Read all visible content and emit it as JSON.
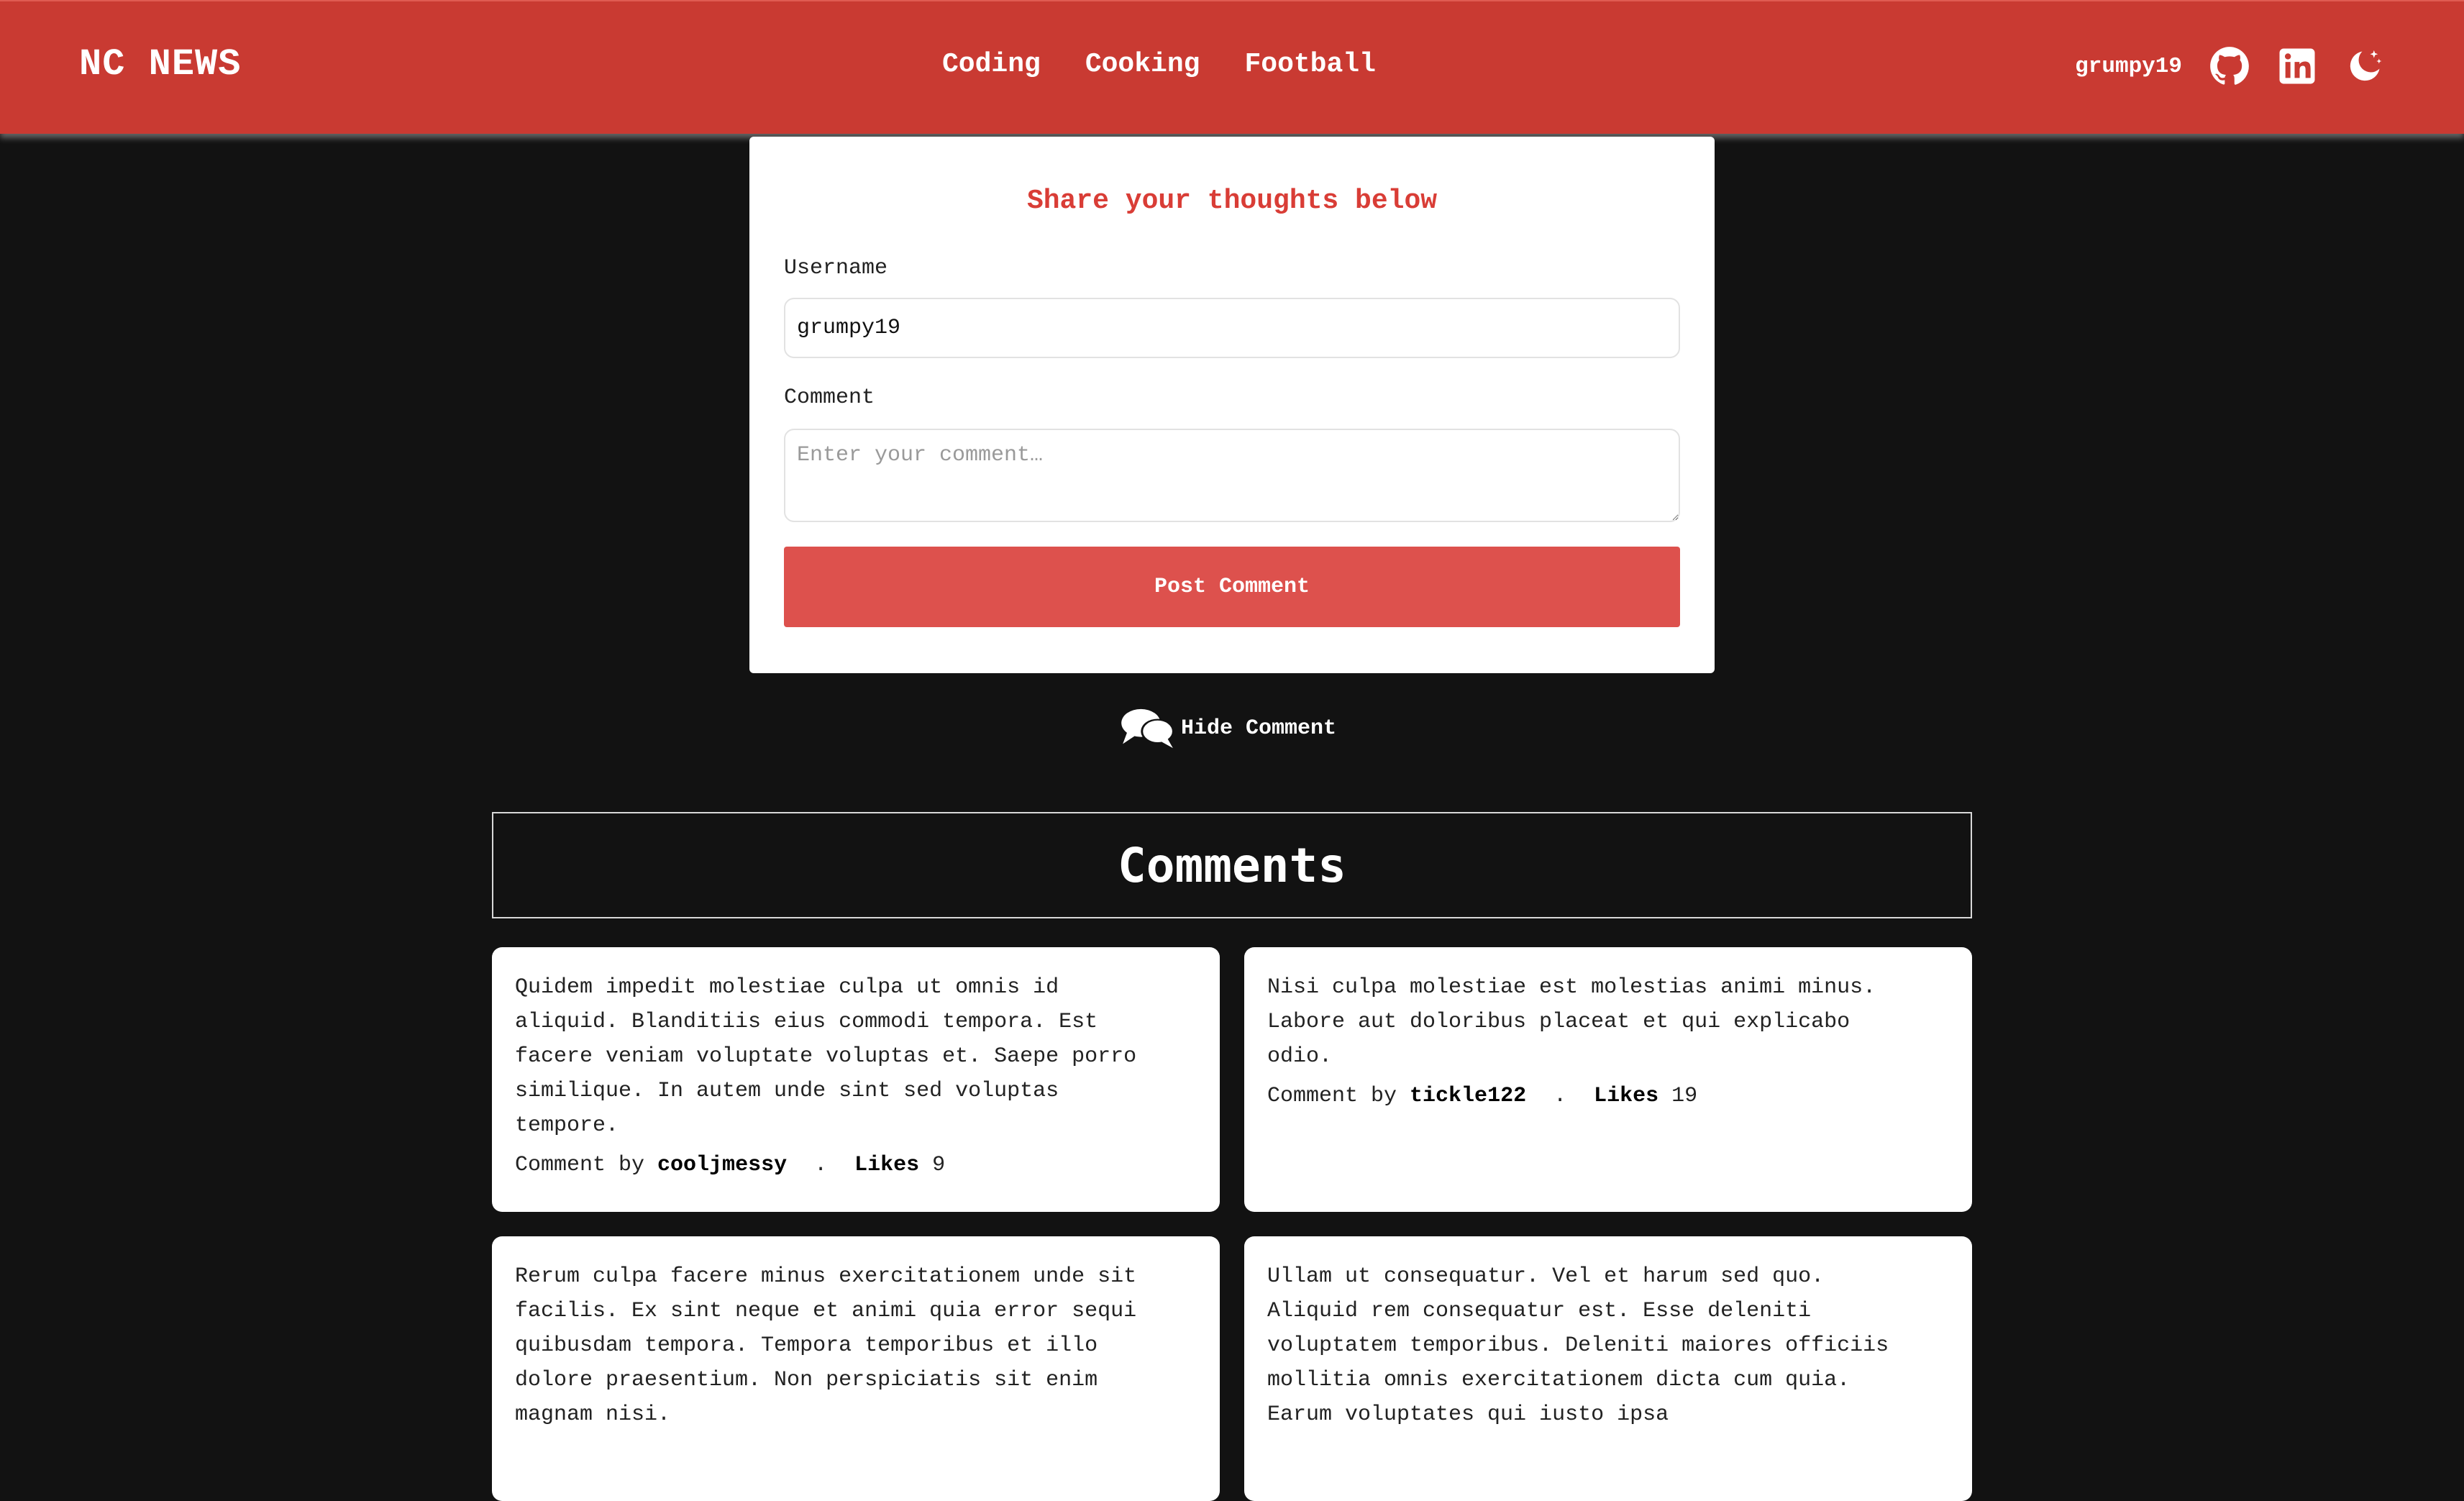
{
  "header": {
    "brand": "NC NEWS",
    "topics": [
      "Coding",
      "Cooking",
      "Football"
    ],
    "username": "grumpy19",
    "icons": [
      "github-icon",
      "linkedin-icon",
      "dark-mode-icon"
    ]
  },
  "form": {
    "title": "Share your thoughts below",
    "username_label": "Username",
    "username_value": "grumpy19",
    "comment_label": "Comment",
    "comment_placeholder": "Enter your comment…",
    "submit_label": "Post Comment"
  },
  "toggle": {
    "icon": "comments-icon",
    "label": "Hide Comment"
  },
  "comments": {
    "heading": "Comments",
    "by_label": "Comment by",
    "separator": ".",
    "likes_label": "Likes",
    "items": [
      {
        "body": "Quidem impedit molestiae culpa ut omnis id aliquid. Blanditiis eius commodi tempora. Est facere veniam voluptate voluptas et. Saepe porro similique. In autem unde sint sed voluptas tempore.",
        "author": "cooljmessy",
        "likes": "9"
      },
      {
        "body": "Nisi culpa molestiae est molestias animi minus. Labore aut doloribus placeat et qui explicabo odio.",
        "author": "tickle122",
        "likes": "19"
      },
      {
        "body": "Rerum culpa facere minus exercitationem unde sit facilis. Ex sint neque et animi quia error sequi quibusdam tempora. Tempora temporibus et illo dolore praesentium. Non perspiciatis sit enim magnam nisi.",
        "author": "",
        "likes": ""
      },
      {
        "body": "Ullam ut consequatur. Vel et harum sed quo. Aliquid rem consequatur est. Esse deleniti voluptatem temporibus. Deleniti maiores officiis mollitia omnis exercitationem dicta cum quia. Earum voluptates qui iusto ipsa",
        "author": "",
        "likes": ""
      }
    ]
  },
  "colors": {
    "header_bg": "#c93a32",
    "page_bg": "#121212",
    "accent": "#d93d36",
    "button_bg": "#dd514d"
  }
}
